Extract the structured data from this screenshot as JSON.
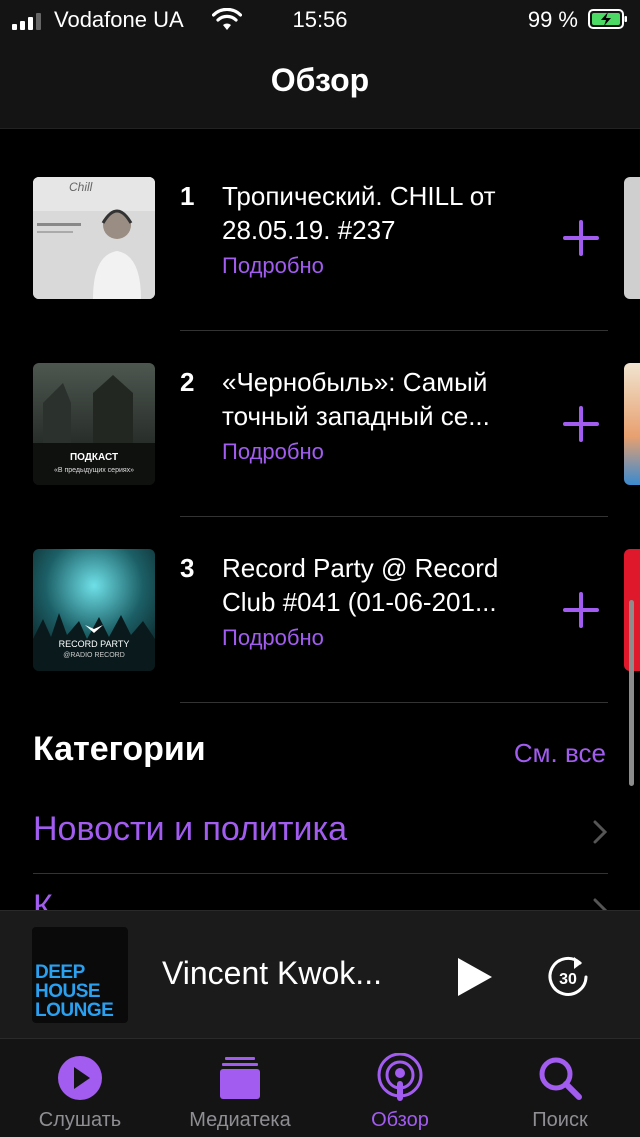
{
  "status_bar": {
    "carrier": "Vodafone UA",
    "time": "15:56",
    "battery_percent": "99 %",
    "signal_icon": "signal-icon",
    "wifi_icon": "wifi-icon",
    "battery_icon": "battery-charging-icon"
  },
  "nav": {
    "title": "Обзор"
  },
  "episodes": [
    {
      "rank": "1",
      "title": "Тропический. CHILL от 28.05.19. #237",
      "more": "Подробно",
      "artwork_text": "Chill"
    },
    {
      "rank": "2",
      "title": "«Чернобыль»: Самый точный западный се...",
      "more": "Подробно",
      "artwork_text": "ПОДКАСТ",
      "artwork_subtext": "«В предыдущих сериях»"
    },
    {
      "rank": "3",
      "title": "Record Party @ Record Club #041 (01-06-201...",
      "more": "Подробно",
      "artwork_text": "RECORD PARTY",
      "artwork_subtext": "@RADIO RECORD"
    }
  ],
  "categories": {
    "heading": "Категории",
    "see_all": "См. все",
    "items": [
      {
        "label": "Новости и политика"
      },
      {
        "label": "К..."
      }
    ]
  },
  "now_playing": {
    "title": "Vincent Kwok...",
    "cover_lines": [
      "DEEP",
      "HOUSE",
      "LOUNGE"
    ],
    "skip_seconds": "30"
  },
  "tabs": [
    {
      "label": "Слушать",
      "icon": "play-circle-icon",
      "active": false
    },
    {
      "label": "Медиатека",
      "icon": "library-icon",
      "active": false
    },
    {
      "label": "Обзор",
      "icon": "podcast-icon",
      "active": true
    },
    {
      "label": "Поиск",
      "icon": "search-icon",
      "active": false
    }
  ],
  "colors": {
    "accent": "#a25cf0",
    "background": "#000000",
    "bar": "#141414"
  }
}
